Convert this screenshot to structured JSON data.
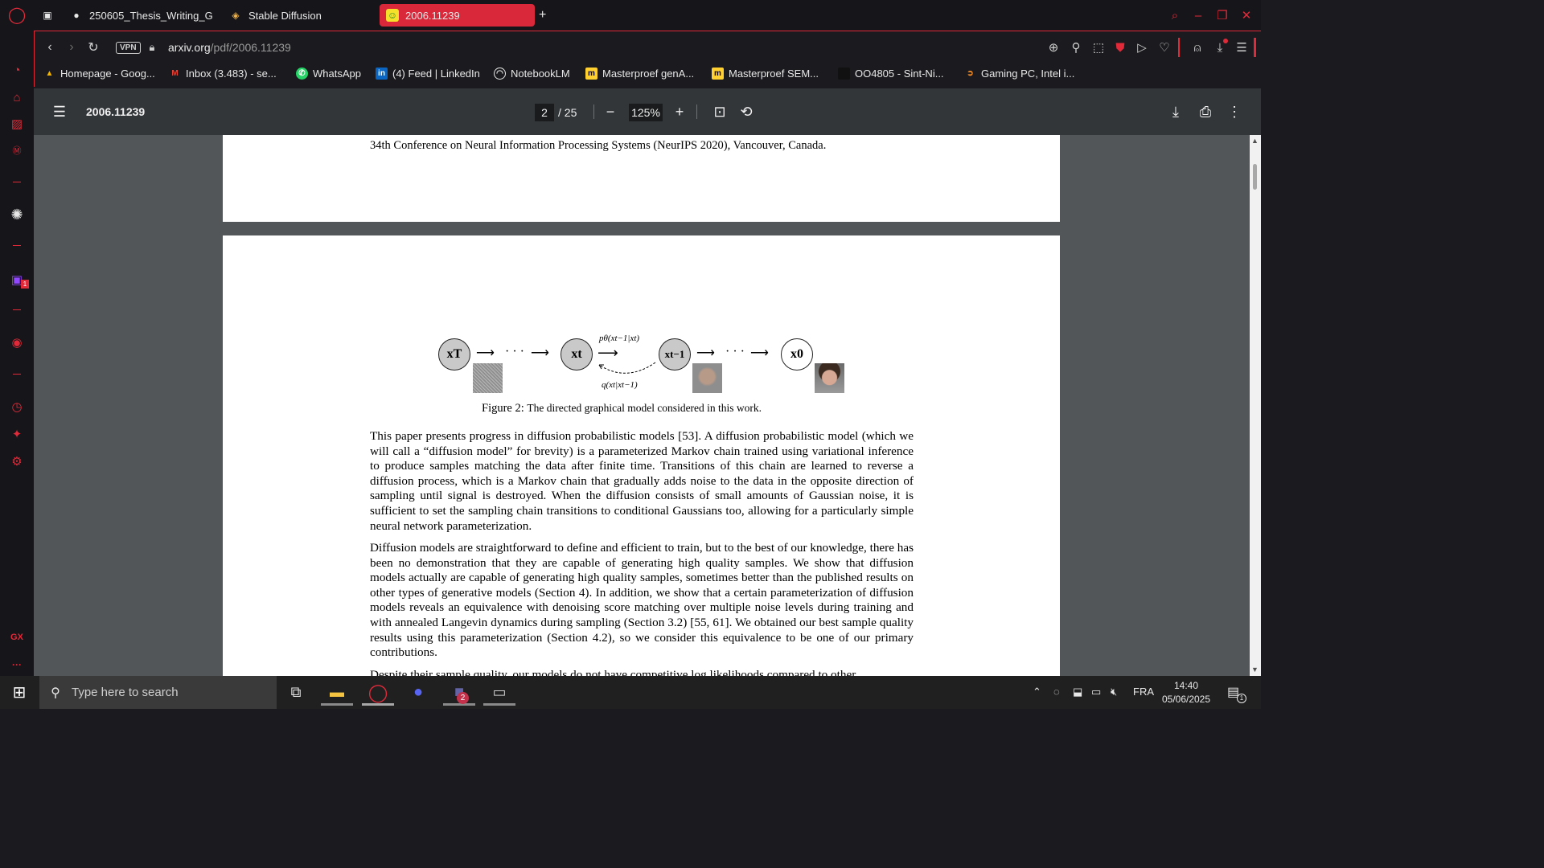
{
  "browser": {
    "tabs": [
      {
        "label": "250605_Thesis_Writing_G",
        "icon": "globe-icon",
        "active": false
      },
      {
        "label": "Stable Diffusion",
        "icon": "layers-icon",
        "active": false
      },
      {
        "label": "2006.11239",
        "icon": "arxiv-icon",
        "active": true
      }
    ],
    "new_tab": "+",
    "vpn_label": "VPN",
    "url_host": "arxiv.org",
    "url_path": "/pdf/2006.11239",
    "accent_color": "#e02a3a"
  },
  "bookmarks": [
    {
      "label": "Homepage - Goog...",
      "icon": "drive-icon"
    },
    {
      "label": "Inbox (3.483) - se...",
      "icon": "gmail-icon"
    },
    {
      "label": "WhatsApp",
      "icon": "whatsapp-icon"
    },
    {
      "label": "(4) Feed | LinkedIn",
      "icon": "linkedin-icon"
    },
    {
      "label": "NotebookLM",
      "icon": "notebooklm-icon"
    },
    {
      "label": "Masterproef genA...",
      "icon": "miro-icon"
    },
    {
      "label": "Masterproef SEM...",
      "icon": "miro-icon"
    },
    {
      "label": "OO4805 - Sint-Ni...",
      "icon": "site-icon"
    },
    {
      "label": "Gaming PC, Intel i...",
      "icon": "shop-icon"
    }
  ],
  "pdf_viewer": {
    "title": "2006.11239",
    "current_page": "2",
    "total_pages": "/ 25",
    "zoom": "125%"
  },
  "document": {
    "conference_line": "34th Conference on Neural Information Processing Systems (NeurIPS 2020), Vancouver, Canada.",
    "figure": {
      "nodes": [
        "xT",
        "xt",
        "xt−1",
        "x0"
      ],
      "ellipsis": "· · ·",
      "p_label": "pθ(xt−1|xt)",
      "q_label": "q(xt|xt−1)",
      "caption_prefix": "Figure 2:",
      "caption_text": "The directed graphical model considered in this work."
    },
    "paragraphs": [
      "This paper presents progress in diffusion probabilistic models [53]. A diffusion probabilistic model (which we will call a “diffusion model” for brevity) is a parameterized Markov chain trained using variational inference to produce samples matching the data after finite time. Transitions of this chain are learned to reverse a diffusion process, which is a Markov chain that gradually adds noise to the data in the opposite direction of sampling until signal is destroyed. When the diffusion consists of small amounts of Gaussian noise, it is sufficient to set the sampling chain transitions to conditional Gaussians too, allowing for a particularly simple neural network parameterization.",
      "Diffusion models are straightforward to define and efficient to train, but to the best of our knowledge, there has been no demonstration that they are capable of generating high quality samples. We show that diffusion models actually are capable of generating high quality samples, sometimes better than the published results on other types of generative models (Section 4). In addition, we show that a certain parameterization of diffusion models reveals an equivalence with denoising score matching over multiple noise levels during training and with annealed Langevin dynamics during sampling (Section 3.2) [55, 61]. We obtained our best sample quality results using this parameterization (Section 4.2), so we consider this equivalence to be one of our primary contributions.",
      "Despite their sample quality, our models do not have competitive log likelihoods compared to other"
    ]
  },
  "sidebar": {
    "gx_label": "GX",
    "more_label": "···",
    "twitch_badge": "1"
  },
  "taskbar": {
    "search_placeholder": "Type here to search",
    "teams_badge": "2",
    "language": "FRA",
    "time": "14:40",
    "date": "05/06/2025",
    "notification_count": "1"
  }
}
